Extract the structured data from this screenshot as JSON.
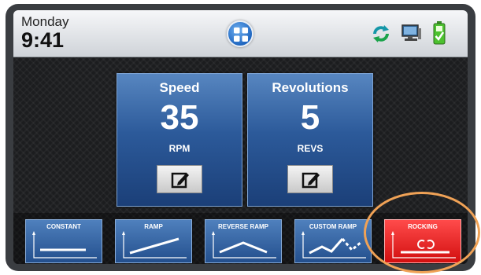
{
  "header": {
    "day": "Monday",
    "time": "9:41",
    "icons": [
      "home-grid-icon",
      "sync-icon",
      "computer-icon",
      "battery-icon"
    ]
  },
  "tiles": [
    {
      "title": "Speed",
      "value": "35",
      "unit": "RPM",
      "edit_icon": "edit-icon"
    },
    {
      "title": "Revolutions",
      "value": "5",
      "unit": "REVS",
      "edit_icon": "edit-icon"
    }
  ],
  "modes": [
    {
      "label": "CONSTANT",
      "icon": "constant-profile-icon"
    },
    {
      "label": "RAMP",
      "icon": "ramp-profile-icon"
    },
    {
      "label": "REVERSE RAMP",
      "icon": "reverse-ramp-profile-icon"
    },
    {
      "label": "CUSTOM RAMP",
      "icon": "custom-ramp-profile-icon"
    },
    {
      "label": "ROCKING",
      "icon": "rocking-profile-icon",
      "selected": true
    }
  ],
  "colors": {
    "tile_blue": "#2c5a9a",
    "selected_red": "#d20f0f",
    "highlight_orange": "#f0a256"
  }
}
